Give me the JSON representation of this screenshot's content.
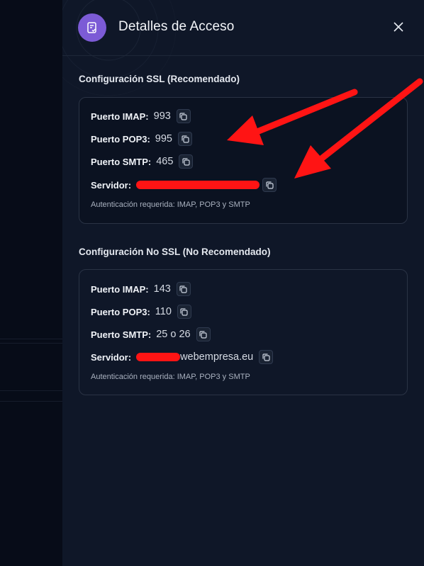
{
  "header": {
    "title": "Detalles de Acceso",
    "icon": "document-check-icon",
    "close_icon": "close-icon",
    "accent_color": "#7c5bd6"
  },
  "ssl": {
    "title": "Configuración SSL (Recomendado)",
    "imap_label": "Puerto IMAP:",
    "imap_value": "993",
    "pop3_label": "Puerto POP3:",
    "pop3_value": "995",
    "smtp_label": "Puerto SMTP:",
    "smtp_value": "465",
    "server_label": "Servidor:",
    "note": "Autenticación requerida: IMAP, POP3 y SMTP"
  },
  "nossl": {
    "title": "Configuración No SSL (No Recomendado)",
    "imap_label": "Puerto IMAP:",
    "imap_value": "143",
    "pop3_label": "Puerto POP3:",
    "pop3_value": "110",
    "smtp_label": "Puerto SMTP:",
    "smtp_value": "25 o 26",
    "server_label": "Servidor:",
    "server_visible": "webempresa.eu",
    "note": "Autenticación requerida: IMAP, POP3 y SMTP"
  },
  "annotations": {
    "arrow_color": "#ff1414",
    "redaction_color": "#ff1414"
  }
}
